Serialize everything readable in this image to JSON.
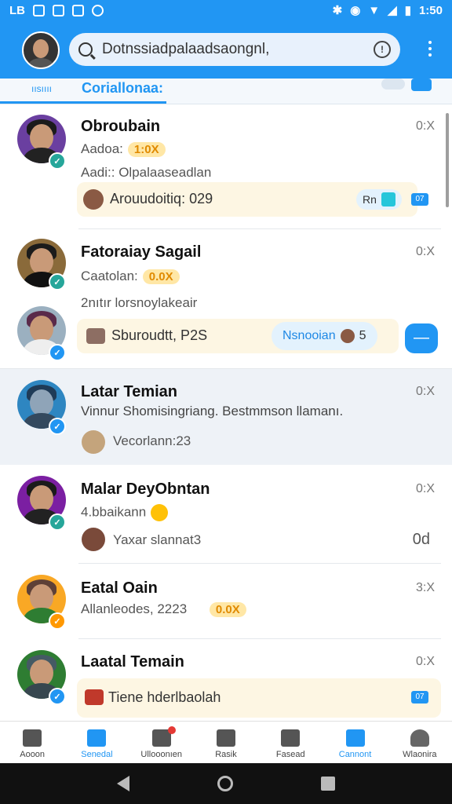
{
  "status_bar": {
    "left_text": "LB",
    "time": "1:50"
  },
  "app_bar": {
    "search_text": "Dotnssiadpalaadsaongnl,"
  },
  "tab_strip": {
    "small_label": "ıısıııı",
    "active_tab": "Coriallonaa:"
  },
  "rows": [
    {
      "name": "Obroubain",
      "time": "0:X",
      "line1_label": "Aadoa:",
      "line1_badge": "1:0X",
      "line2": "Aadi:: Olpalaaseadlan",
      "card_text": "Arouudoitiq: 029",
      "card_chip": "Rn",
      "card_tag": "07"
    },
    {
      "name": "Fatoraiay Sagail",
      "time": "0:X",
      "line1_label": "Caatolan:",
      "line1_badge": "0.0X",
      "line2": "2nıtır lorsnoylakeair",
      "card_text": "Sburoudtt, P2S",
      "card_chip": "Nsnooian",
      "card_chip_num": "5",
      "fab_label": "—"
    },
    {
      "name": "Latar Temian",
      "time": "0:X",
      "line1": "Vinnur Shomisingriang. Bestmmson llamanı.",
      "line2": "Vecorlann:23"
    },
    {
      "name": "Malar DeyObntan",
      "time": "0:X",
      "line1": "4.bbaikann",
      "line2": "Yaxar slannat3",
      "right_tag": "0d"
    },
    {
      "name": "Eatal Oain",
      "time": "3:X",
      "line1": "Allanleodes, 2223",
      "line1_badge": "0.0X"
    },
    {
      "name": "Laatal Temain",
      "time": "0:X",
      "card_text": "Tiene hderlbaolah",
      "card_tag": "07"
    }
  ],
  "bottom_nav": [
    {
      "label": "Aooon",
      "icon": "home-icon"
    },
    {
      "label": "Senedal",
      "icon": "mail-icon"
    },
    {
      "label": "Ullooonıen",
      "icon": "notification-icon"
    },
    {
      "label": "Rasik",
      "icon": "briefcase-icon"
    },
    {
      "label": "Fasead",
      "icon": "camera-icon"
    },
    {
      "label": "Cannont",
      "icon": "folder-icon"
    },
    {
      "label": "Wlaonira",
      "icon": "profile-icon"
    }
  ],
  "colors": {
    "primary": "#2196f3",
    "highlight_bg": "#ffe7a6",
    "highlight_text": "#e08a00",
    "card_bg": "#fdf6e3"
  }
}
